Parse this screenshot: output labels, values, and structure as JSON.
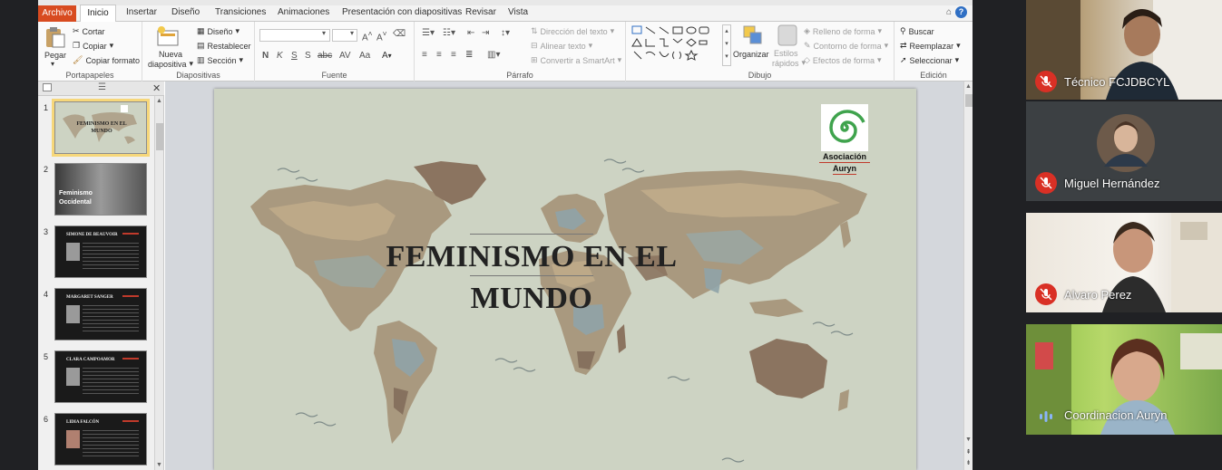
{
  "menubar": {
    "file": "Archivo",
    "tabs": [
      "Inicio",
      "Insertar",
      "Diseño",
      "Transiciones",
      "Animaciones",
      "Presentación con diapositivas",
      "Revisar",
      "Vista"
    ]
  },
  "ribbon": {
    "clipboard": {
      "label": "Portapapeles",
      "paste": "Pegar",
      "cut": "Cortar",
      "copy": "Copiar",
      "copy_format": "Copiar formato"
    },
    "slides": {
      "label": "Diapositivas",
      "new_slide_1": "Nueva",
      "new_slide_2": "diapositiva",
      "layout": "Diseño",
      "reset": "Restablecer",
      "section": "Sección"
    },
    "font": {
      "label": "Fuente"
    },
    "paragraph": {
      "label": "Párrafo",
      "text_direction": "Dirección del texto",
      "align_text": "Alinear texto",
      "smartart": "Convertir a SmartArt"
    },
    "drawing": {
      "label": "Dibujo",
      "arrange": "Organizar",
      "quick_styles_1": "Estilos",
      "quick_styles_2": "rápidos",
      "shape_fill": "Relleno de forma",
      "shape_outline": "Contorno de forma",
      "shape_effects": "Efectos de forma"
    },
    "editing": {
      "label": "Edición",
      "find": "Buscar",
      "replace": "Reemplazar",
      "select": "Seleccionar"
    }
  },
  "slides_panel": {
    "thumbs": [
      {
        "num": "1",
        "title": "FEMINISMO EN EL MUNDO"
      },
      {
        "num": "2",
        "title": "Feminismo Occidental"
      },
      {
        "num": "3",
        "title": "SIMONE DE BEAUVOIR"
      },
      {
        "num": "4",
        "title": "MARGARET SANGER"
      },
      {
        "num": "5",
        "title": "CLARA CAMPOAMOR"
      },
      {
        "num": "6",
        "title": "LIDIA FALCÓN"
      }
    ]
  },
  "slide": {
    "title_line1": "FEMINISMO EN EL",
    "title_line2": "MUNDO",
    "logo_line1": "Asociación",
    "logo_line2": "Auryn"
  },
  "participants": [
    {
      "name": "Técnico FCJDBCYL",
      "muted": true
    },
    {
      "name": "Miguel Hernández",
      "muted": true
    },
    {
      "name": "Alvaro Perez",
      "muted": true
    },
    {
      "name": "Coordinacion Auryn",
      "muted": false
    }
  ],
  "colors": {
    "accent": "#d84b20",
    "mic_muted": "#d93025",
    "slide_bg": "#cdd3c3"
  }
}
